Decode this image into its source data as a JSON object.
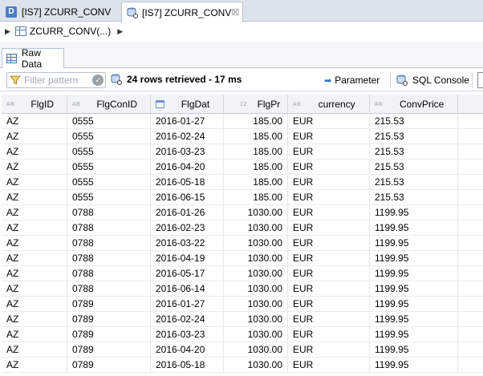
{
  "tabs": [
    {
      "icon": "D",
      "label": "[IS7] ZCURR_CONV"
    },
    {
      "label": "[IS7] ZCURR_CONV",
      "close": "☒"
    }
  ],
  "breadcrumb": {
    "label": "ZCURR_CONV(...)"
  },
  "panel_tab": {
    "label": "Raw Data"
  },
  "toolbar": {
    "filter_placeholder": "Filter pattern",
    "status": "24 rows retrieved - 17 ms",
    "parameter_label": "Parameter",
    "sql_console_label": "SQL Console"
  },
  "table": {
    "columns": [
      {
        "type": "AB",
        "label": "FlgID"
      },
      {
        "type": "AB",
        "label": "FlgConID"
      },
      {
        "type": "date",
        "label": "FlgDat"
      },
      {
        "type": "12",
        "label": "FlgPr"
      },
      {
        "type": "AB",
        "label": "currency"
      },
      {
        "type": "AB",
        "label": "ConvPrice"
      }
    ],
    "rows": [
      [
        "AZ",
        "0555",
        "2016-01-27",
        "185.00",
        "EUR",
        "215.53"
      ],
      [
        "AZ",
        "0555",
        "2016-02-24",
        "185.00",
        "EUR",
        "215.53"
      ],
      [
        "AZ",
        "0555",
        "2016-03-23",
        "185.00",
        "EUR",
        "215.53"
      ],
      [
        "AZ",
        "0555",
        "2016-04-20",
        "185.00",
        "EUR",
        "215.53"
      ],
      [
        "AZ",
        "0555",
        "2016-05-18",
        "185.00",
        "EUR",
        "215.53"
      ],
      [
        "AZ",
        "0555",
        "2016-06-15",
        "185.00",
        "EUR",
        "215.53"
      ],
      [
        "AZ",
        "0788",
        "2016-01-26",
        "1030.00",
        "EUR",
        "1199.95"
      ],
      [
        "AZ",
        "0788",
        "2016-02-23",
        "1030.00",
        "EUR",
        "1199.95"
      ],
      [
        "AZ",
        "0788",
        "2016-03-22",
        "1030.00",
        "EUR",
        "1199.95"
      ],
      [
        "AZ",
        "0788",
        "2016-04-19",
        "1030.00",
        "EUR",
        "1199.95"
      ],
      [
        "AZ",
        "0788",
        "2016-05-17",
        "1030.00",
        "EUR",
        "1199.95"
      ],
      [
        "AZ",
        "0788",
        "2016-06-14",
        "1030.00",
        "EUR",
        "1199.95"
      ],
      [
        "AZ",
        "0789",
        "2016-01-27",
        "1030.00",
        "EUR",
        "1199.95"
      ],
      [
        "AZ",
        "0789",
        "2016-02-24",
        "1030.00",
        "EUR",
        "1199.95"
      ],
      [
        "AZ",
        "0789",
        "2016-03-23",
        "1030.00",
        "EUR",
        "1199.95"
      ],
      [
        "AZ",
        "0789",
        "2016-04-20",
        "1030.00",
        "EUR",
        "1199.95"
      ],
      [
        "AZ",
        "0789",
        "2016-05-18",
        "1030.00",
        "EUR",
        "1199.95"
      ]
    ]
  }
}
